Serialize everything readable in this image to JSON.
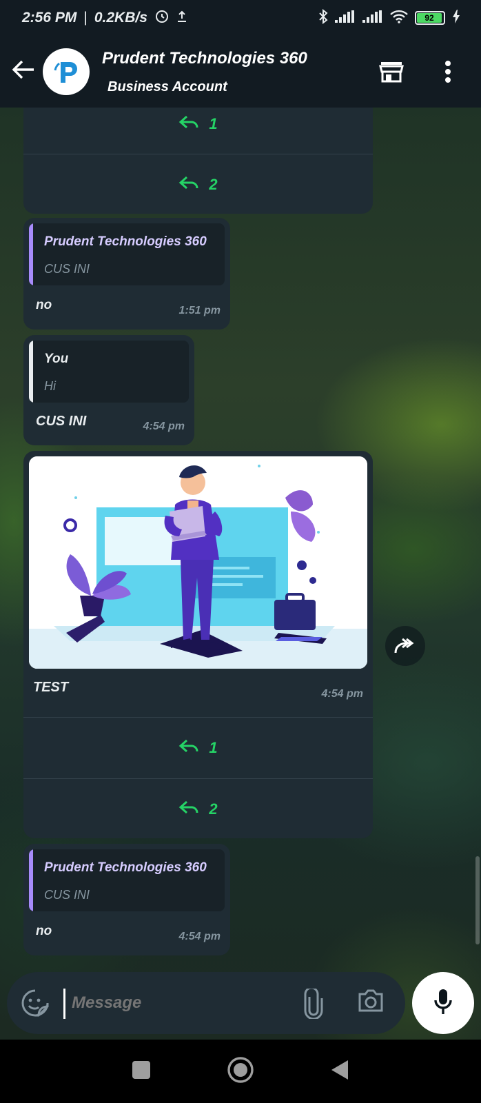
{
  "status_bar": {
    "time": "2:56 PM",
    "separator": "|",
    "speed": "0.2KB/s",
    "battery": "92"
  },
  "header": {
    "title": "Prudent Technologies 360",
    "subtitle": "Business Account",
    "icons": [
      "back-arrow-icon",
      "store-icon",
      "more-vert-icon"
    ]
  },
  "messages": {
    "top_buttons": [
      {
        "label": "1"
      },
      {
        "label": "2"
      }
    ],
    "reply1": {
      "quote_name": "Prudent Technologies 360",
      "quote_text": "CUS INI",
      "text": "no",
      "time": "1:51 pm"
    },
    "reply2": {
      "quote_name": "You",
      "quote_text": "Hi",
      "text": "CUS INI",
      "time": "4:54 pm"
    },
    "media": {
      "caption": "TEST",
      "time": "4:54 pm",
      "buttons": [
        {
          "label": "1"
        },
        {
          "label": "2"
        }
      ]
    },
    "reply3": {
      "quote_name": "Prudent Technologies 360",
      "quote_text": "CUS INI",
      "text": "no",
      "time": "4:54 pm"
    }
  },
  "composer": {
    "placeholder": "Message"
  },
  "colors": {
    "accent": "#25d366",
    "quote_bar_business": "#a78bfa",
    "quote_bar_you": "#e9edef",
    "bubble": "#1f2c34"
  }
}
